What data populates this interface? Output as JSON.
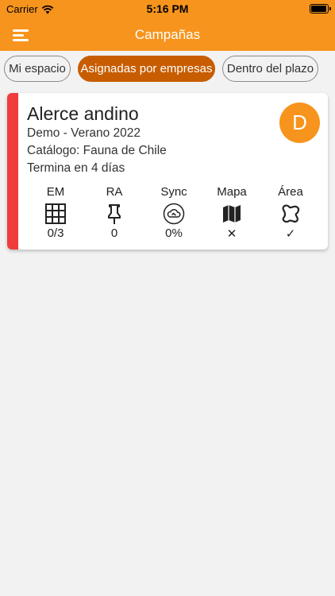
{
  "status_bar": {
    "carrier": "Carrier",
    "time": "5:16 PM"
  },
  "nav": {
    "title": "Campañas"
  },
  "filters": [
    {
      "label": "Mi espacio",
      "active": false
    },
    {
      "label": "Asignadas por empresas",
      "active": true
    },
    {
      "label": "Dentro del plazo",
      "active": false
    }
  ],
  "campaign": {
    "title": "Alerce andino",
    "subtitle": "Demo - Verano 2022",
    "catalog": "Catálogo: Fauna de Chile",
    "deadline": "Termina en 4 días",
    "avatar_initial": "D",
    "accent_color": "#f03c3c",
    "metrics": [
      {
        "label": "EM",
        "icon": "grid-icon",
        "value": "0/3"
      },
      {
        "label": "RA",
        "icon": "pushpin-icon",
        "value": "0"
      },
      {
        "label": "Sync",
        "icon": "cloud-sync-icon",
        "value": "0%"
      },
      {
        "label": "Mapa",
        "icon": "map-icon",
        "value": "✕"
      },
      {
        "label": "Área",
        "icon": "area-shape-icon",
        "value": "✓"
      }
    ]
  },
  "colors": {
    "brand": "#f7941d",
    "active_chip": "#c75d00",
    "background": "#f2f2f2"
  }
}
